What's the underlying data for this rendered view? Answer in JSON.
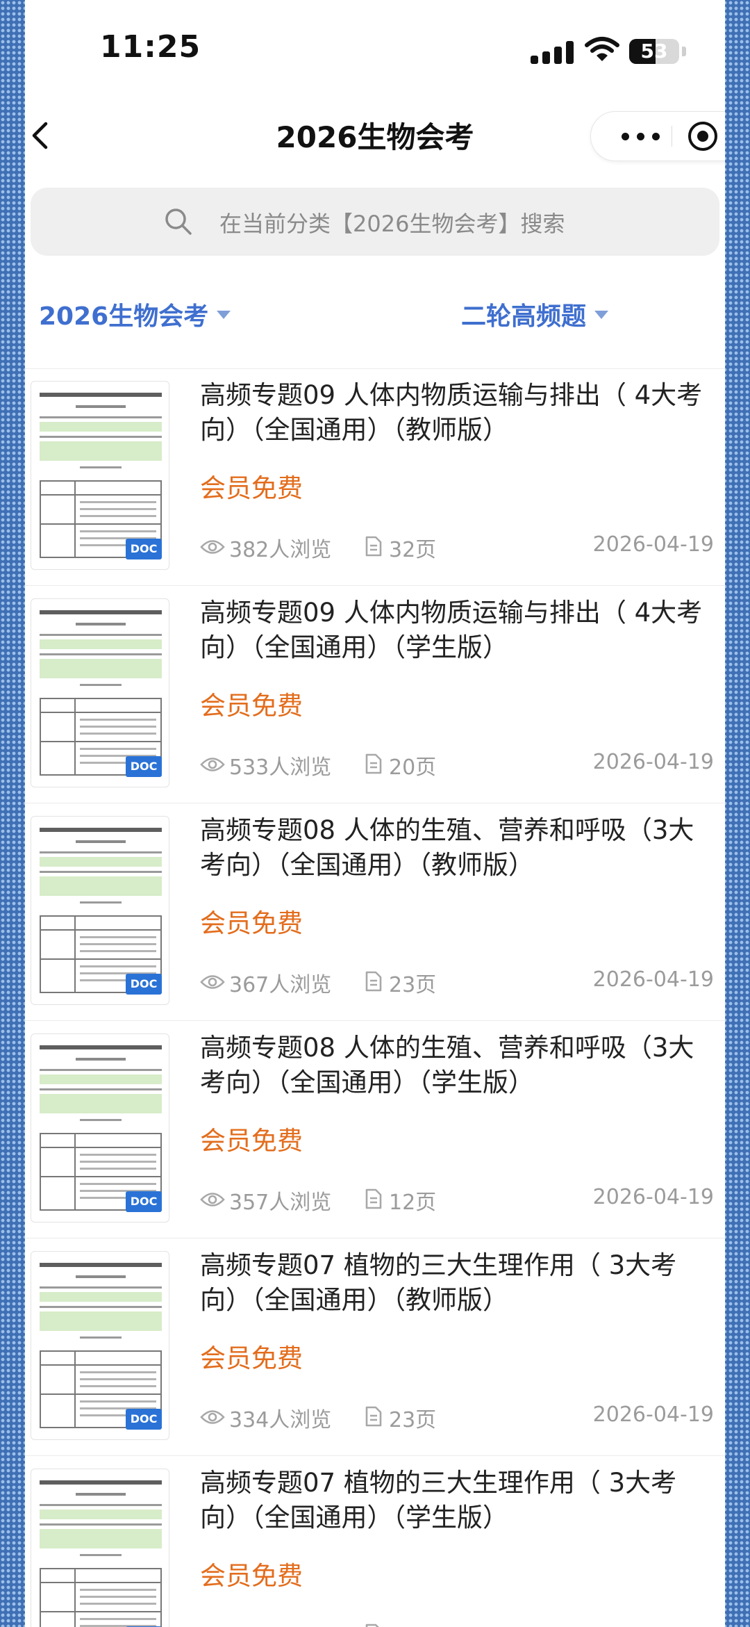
{
  "status_bar": {
    "time": "11:25",
    "battery": "53",
    "battery_level": 0.53
  },
  "nav": {
    "title": "2026生物会考"
  },
  "search": {
    "placeholder": "在当前分类【2026生物会考】搜索"
  },
  "filters": {
    "category": "2026生物会考",
    "subcategory": "二轮高频题"
  },
  "thumb_badge": "DOC",
  "documents": [
    {
      "title": "高频专题09 人体内物质运输与排出（ 4大考向）（全国通用）（教师版）",
      "price": "会员免费",
      "views": "382人浏览",
      "pages": "32页",
      "date": "2026-04-19"
    },
    {
      "title": "高频专题09 人体内物质运输与排出（ 4大考向）（全国通用）（学生版）",
      "price": "会员免费",
      "views": "533人浏览",
      "pages": "20页",
      "date": "2026-04-19"
    },
    {
      "title": "高频专题08 人体的生殖、营养和呼吸（3大考向）（全国通用）（教师版）",
      "price": "会员免费",
      "views": "367人浏览",
      "pages": "23页",
      "date": "2026-04-19"
    },
    {
      "title": "高频专题08 人体的生殖、营养和呼吸（3大考向）（全国通用）（学生版）",
      "price": "会员免费",
      "views": "357人浏览",
      "pages": "12页",
      "date": "2026-04-19"
    },
    {
      "title": "高频专题07 植物的三大生理作用（ 3大考向）（全国通用）（教师版）",
      "price": "会员免费",
      "views": "334人浏览",
      "pages": "23页",
      "date": "2026-04-19"
    },
    {
      "title": "高频专题07 植物的三大生理作用（ 3大考向）（全国通用）（学生版）",
      "price": "会员免费",
      "views": "",
      "pages": "",
      "date": ""
    }
  ]
}
